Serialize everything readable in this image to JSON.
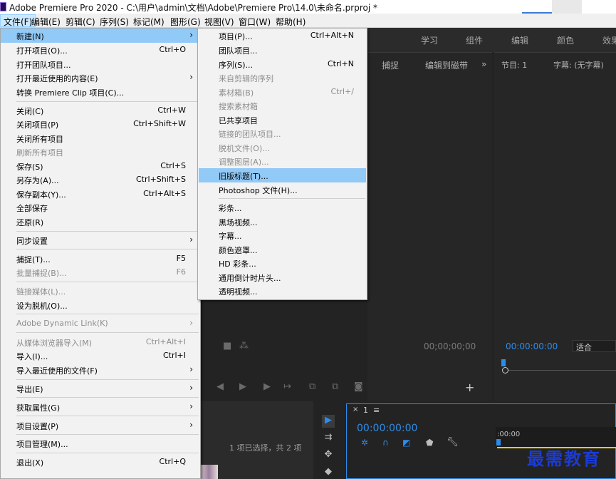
{
  "window": {
    "title": "Adobe Premiere Pro 2020 - C:\\用户\\admin\\文档\\Adobe\\Premiere Pro\\14.0\\未命名.prproj *"
  },
  "menubar": {
    "items": [
      "文件(F)",
      "编辑(E)",
      "剪辑(C)",
      "序列(S)",
      "标记(M)",
      "图形(G)",
      "视图(V)",
      "窗口(W)",
      "帮助(H)"
    ]
  },
  "workspaces": [
    "学习",
    "组件",
    "编辑",
    "颜色",
    "效果"
  ],
  "source_panel": {
    "tabs": [
      "捕捉",
      "编辑到磁带"
    ],
    "more": "»",
    "timecode": "00;00;00;00"
  },
  "program_panel": {
    "title": "节目: 1",
    "captions": "字幕: (无字幕)",
    "timecode": "00:00:00:00",
    "fit": "适合"
  },
  "project_panel": {
    "selection_info": "1 项已选择，共 2 项"
  },
  "timeline": {
    "tab": "1",
    "menu": "≡",
    "timecode": "00:00:00:00",
    "ruler_start": ":00:00"
  },
  "watermark": "最需教育",
  "file_menu": {
    "items": [
      {
        "label": "新建(N)",
        "submenu": true,
        "highlighted": true
      },
      {
        "label": "打开项目(O)...",
        "shortcut": "Ctrl+O"
      },
      {
        "label": "打开团队项目..."
      },
      {
        "label": "打开最近使用的内容(E)",
        "submenu": true
      },
      {
        "label": "转换 Premiere Clip 项目(C)..."
      },
      {
        "label": "关闭(C)",
        "shortcut": "Ctrl+W"
      },
      {
        "label": "关闭项目(P)",
        "shortcut": "Ctrl+Shift+W"
      },
      {
        "label": "关闭所有项目"
      },
      {
        "label": "刷新所有项目",
        "disabled": true
      },
      {
        "label": "保存(S)",
        "shortcut": "Ctrl+S"
      },
      {
        "label": "另存为(A)...",
        "shortcut": "Ctrl+Shift+S"
      },
      {
        "label": "保存副本(Y)...",
        "shortcut": "Ctrl+Alt+S"
      },
      {
        "label": "全部保存"
      },
      {
        "label": "还原(R)"
      },
      {
        "label": "同步设置",
        "submenu": true
      },
      {
        "label": "捕捉(T)...",
        "shortcut": "F5"
      },
      {
        "label": "批量捕捉(B)...",
        "shortcut": "F6",
        "disabled": true
      },
      {
        "label": "链接媒体(L)...",
        "disabled": true
      },
      {
        "label": "设为脱机(O)..."
      },
      {
        "label": "Adobe Dynamic Link(K)",
        "submenu": true,
        "disabled": true
      },
      {
        "label": "从媒体浏览器导入(M)",
        "shortcut": "Ctrl+Alt+I",
        "disabled": true
      },
      {
        "label": "导入(I)...",
        "shortcut": "Ctrl+I"
      },
      {
        "label": "导入最近使用的文件(F)",
        "submenu": true
      },
      {
        "label": "导出(E)",
        "submenu": true
      },
      {
        "label": "获取属性(G)",
        "submenu": true
      },
      {
        "label": "项目设置(P)",
        "submenu": true
      },
      {
        "label": "项目管理(M)..."
      },
      {
        "label": "退出(X)",
        "shortcut": "Ctrl+Q"
      }
    ]
  },
  "new_submenu": {
    "items": [
      {
        "label": "项目(P)...",
        "shortcut": "Ctrl+Alt+N"
      },
      {
        "label": "团队项目..."
      },
      {
        "label": "序列(S)...",
        "shortcut": "Ctrl+N"
      },
      {
        "label": "来自剪辑的序列",
        "disabled": true
      },
      {
        "label": "素材箱(B)",
        "shortcut": "Ctrl+/",
        "disabled": true
      },
      {
        "label": "搜索素材箱",
        "disabled": true
      },
      {
        "label": "已共享项目"
      },
      {
        "label": "链接的团队项目...",
        "disabled": true
      },
      {
        "label": "脱机文件(O)...",
        "disabled": true
      },
      {
        "label": "调整图层(A)...",
        "disabled": true
      },
      {
        "label": "旧版标题(T)...",
        "highlighted": true
      },
      {
        "label": "Photoshop 文件(H)..."
      },
      {
        "label": "彩条..."
      },
      {
        "label": "黑场视频..."
      },
      {
        "label": "字幕..."
      },
      {
        "label": "颜色遮罩..."
      },
      {
        "label": "HD 彩条..."
      },
      {
        "label": "通用倒计时片头..."
      },
      {
        "label": "透明视频..."
      }
    ]
  },
  "icons": {
    "submenu_arrow": "›",
    "app": "premiere-pro-icon"
  },
  "colors": {
    "menu_highlight": "#91c9f7",
    "menubar_open": "#cce8ff",
    "timecode": "#2d8ceb",
    "watermark": "#1b3bd6",
    "playhead_line": "#e5d200"
  }
}
